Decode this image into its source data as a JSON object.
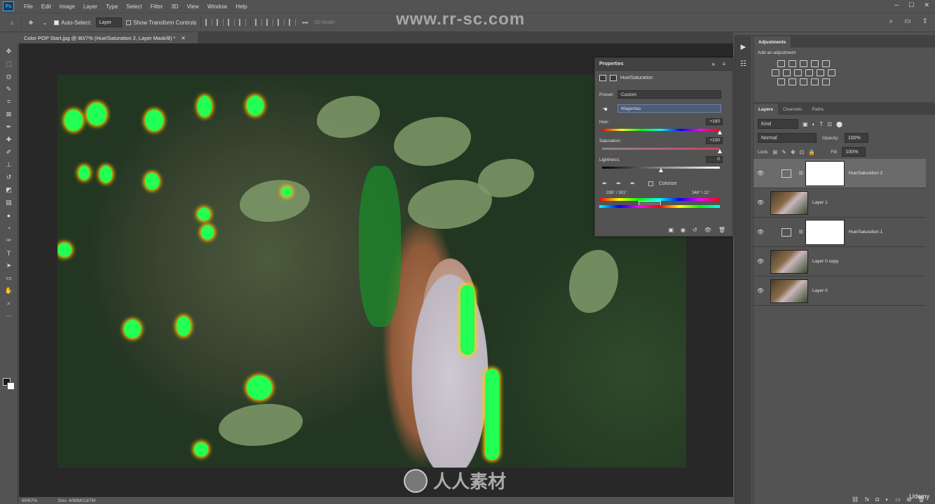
{
  "app": {
    "logo": "Ps"
  },
  "menu": [
    "File",
    "Edit",
    "Image",
    "Layer",
    "Type",
    "Select",
    "Filter",
    "3D",
    "View",
    "Window",
    "Help"
  ],
  "options": {
    "auto_select_label": "Auto-Select:",
    "auto_select_value": "Layer",
    "transform_label": "Show Transform Controls",
    "mode_label": "3D Mode:"
  },
  "document": {
    "tab_title": "Color POP Start.jpg @ 80/7% (Hue/Saturation 2, Layer Mask/8) *",
    "zoom": "80/67%",
    "doc_info": "Doc: 4/58M/13/7M"
  },
  "watermark": {
    "url": "www.rr-sc.com",
    "brand": "人人素材",
    "udemy": "Udemy"
  },
  "properties": {
    "title": "Properties",
    "type": "Hue/Saturation",
    "preset_label": "Preset:",
    "preset_value": "Custom",
    "channel_value": "Magentas",
    "hue_label": "Hue:",
    "hue_value": "+180",
    "saturation_label": "Saturation:",
    "saturation_value": "+100",
    "lightness_label": "Lightness:",
    "lightness_value": "0",
    "colorize_label": "Colorize",
    "range_left": "295° / 301°",
    "range_right": "348° \\ 11°",
    "hue_position": 1.0,
    "saturation_position": 1.0,
    "lightness_position": 0.5
  },
  "adjustments": {
    "tab": "Adjustments",
    "subtitle": "Add an adjustment"
  },
  "layers_panel": {
    "tabs": [
      "Layers",
      "Channels",
      "Paths"
    ],
    "kind": "Kind",
    "blend_mode": "Normal",
    "opacity_label": "Opacity:",
    "opacity_value": "100%",
    "lock_label": "Lock:",
    "fill_label": "Fill:",
    "fill_value": "100%",
    "layers": [
      {
        "name": "Hue/Saturation 2",
        "kind": "adjustment",
        "selected": true
      },
      {
        "name": "Layer 1",
        "kind": "pixel",
        "selected": false
      },
      {
        "name": "Hue/Saturation 1",
        "kind": "adjustment",
        "selected": false
      },
      {
        "name": "Layer 0 copy",
        "kind": "pixel",
        "selected": false
      },
      {
        "name": "Layer 0",
        "kind": "pixel",
        "selected": false
      }
    ]
  }
}
